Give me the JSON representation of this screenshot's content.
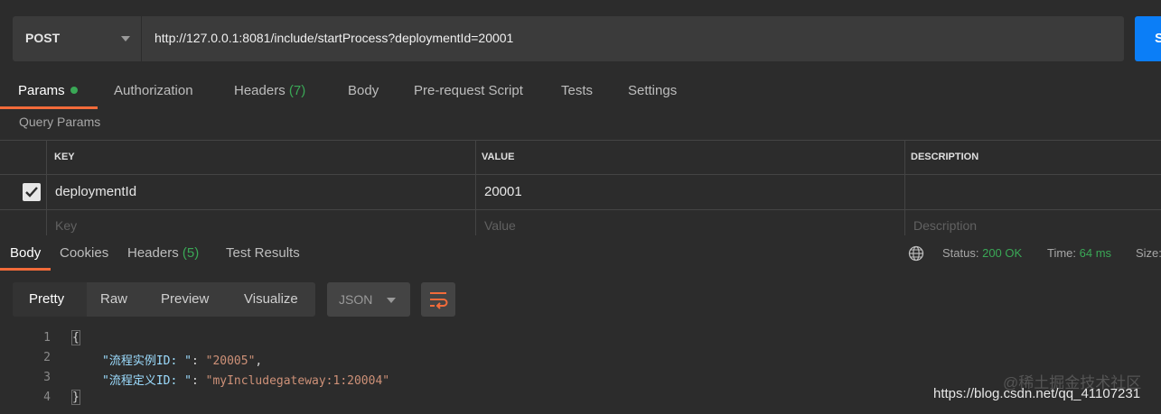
{
  "request": {
    "method": "POST",
    "url": "http://127.0.0.1:8081/include/startProcess?deploymentId=20001",
    "send_label": "S"
  },
  "request_tabs": [
    {
      "label": "Params"
    },
    {
      "label": "Authorization"
    },
    {
      "label": "Headers",
      "count": "(7)"
    },
    {
      "label": "Body"
    },
    {
      "label": "Pre-request Script"
    },
    {
      "label": "Tests"
    },
    {
      "label": "Settings"
    }
  ],
  "query_params": {
    "title": "Query Params",
    "columns": [
      "KEY",
      "VALUE",
      "DESCRIPTION"
    ],
    "rows": [
      {
        "key": "deploymentId",
        "value": "20001",
        "description": "",
        "checked": true
      }
    ],
    "placeholders": {
      "key": "Key",
      "value": "Value",
      "description": "Description"
    }
  },
  "response": {
    "tabs": [
      {
        "label": "Body"
      },
      {
        "label": "Cookies"
      },
      {
        "label": "Headers",
        "count": "(5)"
      },
      {
        "label": "Test Results"
      }
    ],
    "status_label": "Status:",
    "status_value": "200 OK",
    "time_label": "Time:",
    "time_value": "64 ms",
    "size_label": "Size:"
  },
  "view_modes": [
    "Pretty",
    "Raw",
    "Preview",
    "Visualize"
  ],
  "format": "JSON",
  "code_lines": [
    {
      "n": "1",
      "text": "{"
    },
    {
      "n": "2",
      "key": "\"流程实例ID: \"",
      "value": "\"20005\"",
      "sep": ": ",
      "end": ","
    },
    {
      "n": "3",
      "key": "\"流程定义ID: \"",
      "value": "\"myIncludegateway:1:20004\"",
      "sep": ": ",
      "end": ""
    },
    {
      "n": "4",
      "text": "}"
    }
  ],
  "watermark": {
    "url": "https://blog.csdn.net/qq_41107231",
    "text": "@稀土掘金技术社区"
  },
  "colors": {
    "accent": "#f26b3a",
    "send": "#0b7ef7",
    "success": "#3aa856"
  }
}
